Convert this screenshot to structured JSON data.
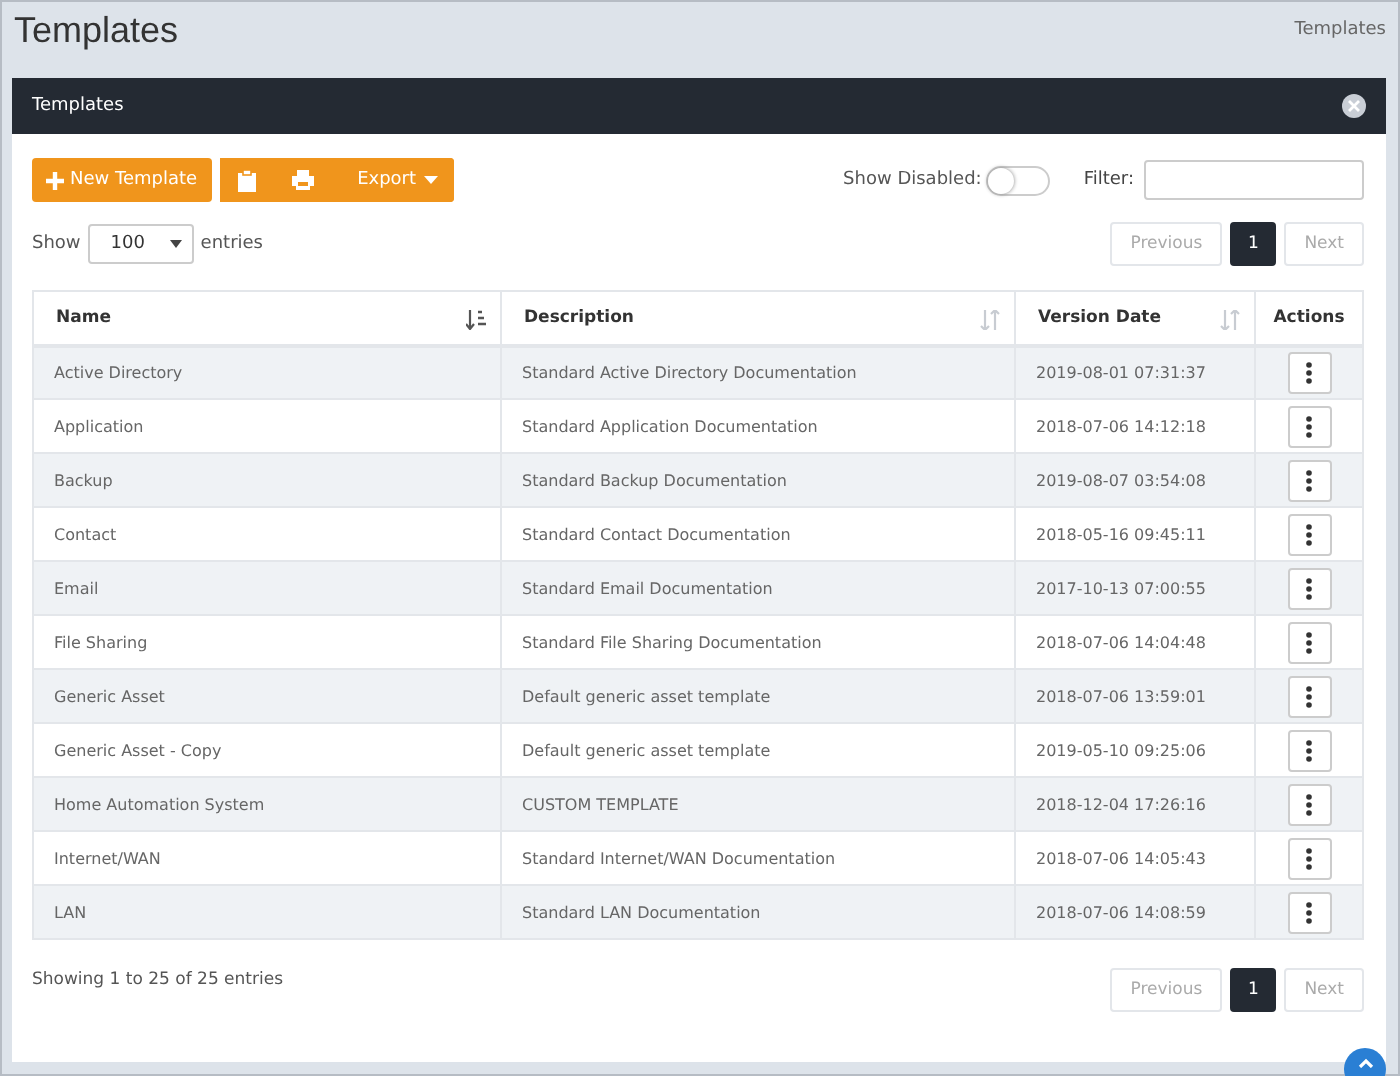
{
  "page": {
    "title": "Templates",
    "breadcrumb": "Templates"
  },
  "panel": {
    "title": "Templates"
  },
  "toolbar": {
    "new_button": "New Template",
    "export_button": "Export",
    "show_disabled": {
      "label": "Show Disabled:",
      "on": false
    },
    "filter": {
      "label": "Filter:"
    }
  },
  "length": {
    "before": "Show",
    "value": "100",
    "after": "entries"
  },
  "pagination_top": {
    "previous": {
      "label": "Previous",
      "disabled": true
    },
    "pages": [
      {
        "label": "1",
        "selected": true
      }
    ],
    "next": {
      "label": "Next",
      "disabled": true
    }
  },
  "table": {
    "columns": [
      {
        "label": "Name",
        "sorted": true
      },
      {
        "label": "Description",
        "sorted": false
      },
      {
        "label": "Version Date",
        "sorted": false
      },
      {
        "label": "Actions"
      }
    ],
    "rows": [
      [
        "Active Directory",
        "Standard Active Directory Documentation",
        "2019-08-01 07:31:37"
      ],
      [
        "Application",
        "Standard Application Documentation",
        "2018-07-06 14:12:18"
      ],
      [
        "Backup",
        "Standard Backup Documentation",
        "2019-08-07 03:54:08"
      ],
      [
        "Contact",
        "Standard Contact Documentation",
        "2018-05-16 09:45:11"
      ],
      [
        "Email",
        "Standard Email Documentation",
        "2017-10-13 07:00:55"
      ],
      [
        "File Sharing",
        "Standard File Sharing Documentation",
        "2018-07-06 14:04:48"
      ],
      [
        "Generic Asset",
        "Default generic asset template",
        "2018-07-06 13:59:01"
      ],
      [
        "Generic Asset - Copy",
        "Default generic asset template",
        "2019-05-10 09:25:06"
      ],
      [
        "Home Automation System",
        "CUSTOM TEMPLATE",
        "2018-12-04 17:26:16"
      ],
      [
        "Internet/WAN",
        "Standard Internet/WAN Documentation",
        "2018-07-06 14:05:43"
      ],
      [
        "LAN",
        "Standard LAN Documentation",
        "2018-07-06 14:08:59"
      ]
    ]
  },
  "info": "Showing 1 to 25 of 25 entries",
  "pagination_bottom": {
    "previous": {
      "label": "Previous",
      "disabled": true
    },
    "pages": [
      {
        "label": "1",
        "selected": true
      }
    ],
    "next": {
      "label": "Next",
      "disabled": true
    }
  }
}
